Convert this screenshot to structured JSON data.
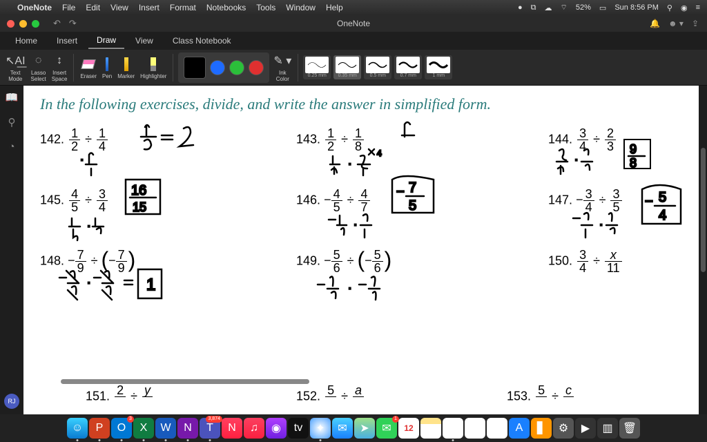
{
  "menubar": {
    "app": "OneNote",
    "items": [
      "File",
      "Edit",
      "View",
      "Insert",
      "Format",
      "Notebooks",
      "Tools",
      "Window",
      "Help"
    ],
    "battery": "52%",
    "clock": "Sun 8:56 PM"
  },
  "titlebar": {
    "title": "OneNote"
  },
  "tabs": [
    "Home",
    "Insert",
    "Draw",
    "View",
    "Class Notebook"
  ],
  "active_tab": "Draw",
  "tools": {
    "text_mode": "Text\nMode",
    "lasso": "Lasso\nSelect",
    "insert_space": "Insert\nSpace",
    "eraser": "Eraser",
    "pen": "Pen",
    "marker": "Marker",
    "highlighter": "Highlighter",
    "ink_color": "Ink\nColor"
  },
  "colors": {
    "current": "#000000",
    "palette": [
      "#1e6bff",
      "#2bbf3a",
      "#e03030"
    ]
  },
  "thickness": [
    "0.25 mm",
    "0.35 mm",
    "0.5 mm",
    "0.7 mm",
    "1 mm"
  ],
  "thickness_sel": 1,
  "heading": "In the following exercises, divide, and write the answer in simplified form.",
  "problems": {
    "p142": {
      "num": "142.",
      "a_n": "1",
      "a_d": "2",
      "b_n": "1",
      "b_d": "4"
    },
    "p143": {
      "num": "143.",
      "a_n": "1",
      "a_d": "2",
      "b_n": "1",
      "b_d": "8"
    },
    "p144": {
      "num": "144.",
      "a_n": "3",
      "a_d": "4",
      "b_n": "2",
      "b_d": "3"
    },
    "p145": {
      "num": "145.",
      "a_n": "4",
      "a_d": "5",
      "b_n": "3",
      "b_d": "4"
    },
    "p146": {
      "num": "146.",
      "a_n": "4",
      "a_d": "5",
      "b_n": "4",
      "b_d": "7"
    },
    "p147": {
      "num": "147.",
      "a_n": "3",
      "a_d": "4",
      "b_n": "3",
      "b_d": "5"
    },
    "p148": {
      "num": "148.",
      "a_n": "7",
      "a_d": "9",
      "b_n": "7",
      "b_d": "9"
    },
    "p149": {
      "num": "149.",
      "a_n": "5",
      "a_d": "6",
      "b_n": "5",
      "b_d": "6"
    },
    "p150": {
      "num": "150.",
      "a_n": "3",
      "a_d": "4",
      "b_n": "x",
      "b_d": "11"
    },
    "p151": {
      "num": "151.",
      "a_n": "2",
      "a_d": "",
      "b_n": "y",
      "b_d": ""
    },
    "p152": {
      "num": "152.",
      "a_n": "5",
      "a_d": "",
      "b_n": "a",
      "b_d": ""
    },
    "p153": {
      "num": "153.",
      "a_n": "5",
      "a_d": "",
      "b_n": "c",
      "b_d": ""
    }
  },
  "avatar": "RJ",
  "dock": [
    {
      "name": "finder",
      "bg": "linear-gradient(#3ad0ff,#0a7bd0)",
      "glyph": "☺",
      "dot": true
    },
    {
      "name": "powerpoint",
      "bg": "#d04020",
      "glyph": "P",
      "dot": true,
      "badge": ""
    },
    {
      "name": "outlook",
      "bg": "#0078d4",
      "glyph": "O",
      "dot": true,
      "badge": "3"
    },
    {
      "name": "excel",
      "bg": "#107c41",
      "glyph": "X",
      "dot": true
    },
    {
      "name": "word",
      "bg": "#185abd",
      "glyph": "W",
      "dot": true
    },
    {
      "name": "onenote",
      "bg": "#7719aa",
      "glyph": "N",
      "dot": true
    },
    {
      "name": "teams",
      "bg": "#4b53bc",
      "glyph": "T",
      "dot": true,
      "badge": "3,874"
    },
    {
      "name": "news",
      "bg": "linear-gradient(#ff4060,#ff2040)",
      "glyph": "N"
    },
    {
      "name": "music",
      "bg": "linear-gradient(#fa4060,#fa2040)",
      "glyph": "♫"
    },
    {
      "name": "podcasts",
      "bg": "linear-gradient(#b040ff,#7020e0)",
      "glyph": "◉"
    },
    {
      "name": "appletv",
      "bg": "#111",
      "glyph": "tv"
    },
    {
      "name": "safari",
      "bg": "radial-gradient(#fff,#4aa0ff)",
      "glyph": "✦",
      "dot": true
    },
    {
      "name": "mail",
      "bg": "linear-gradient(#4ad0ff,#1a80ff)",
      "glyph": "✉"
    },
    {
      "name": "maps",
      "bg": "linear-gradient(#9de08a,#4ab0e0)",
      "glyph": "➤"
    },
    {
      "name": "messages",
      "bg": "#30d158",
      "glyph": "✉",
      "badge": "1"
    },
    {
      "name": "calendar",
      "bg": "#fff",
      "glyph": "12"
    },
    {
      "name": "notes",
      "bg": "linear-gradient(#ffe38a 30%,#fff 30%)",
      "glyph": ""
    },
    {
      "name": "chrome",
      "bg": "#fff",
      "glyph": "◉",
      "dot": true
    },
    {
      "name": "reminders",
      "bg": "#fff",
      "glyph": "≡"
    },
    {
      "name": "photos",
      "bg": "#fff",
      "glyph": "✣"
    },
    {
      "name": "appstore",
      "bg": "#1a80ff",
      "glyph": "A"
    },
    {
      "name": "books",
      "bg": "#ff9500",
      "glyph": "▋"
    },
    {
      "name": "settings",
      "bg": "#555",
      "glyph": "⚙"
    },
    {
      "name": "video",
      "bg": "#333",
      "glyph": "▶"
    },
    {
      "name": "desktop",
      "bg": "#333",
      "glyph": "▥"
    },
    {
      "name": "trash",
      "bg": "#555",
      "glyph": "🗑"
    }
  ]
}
